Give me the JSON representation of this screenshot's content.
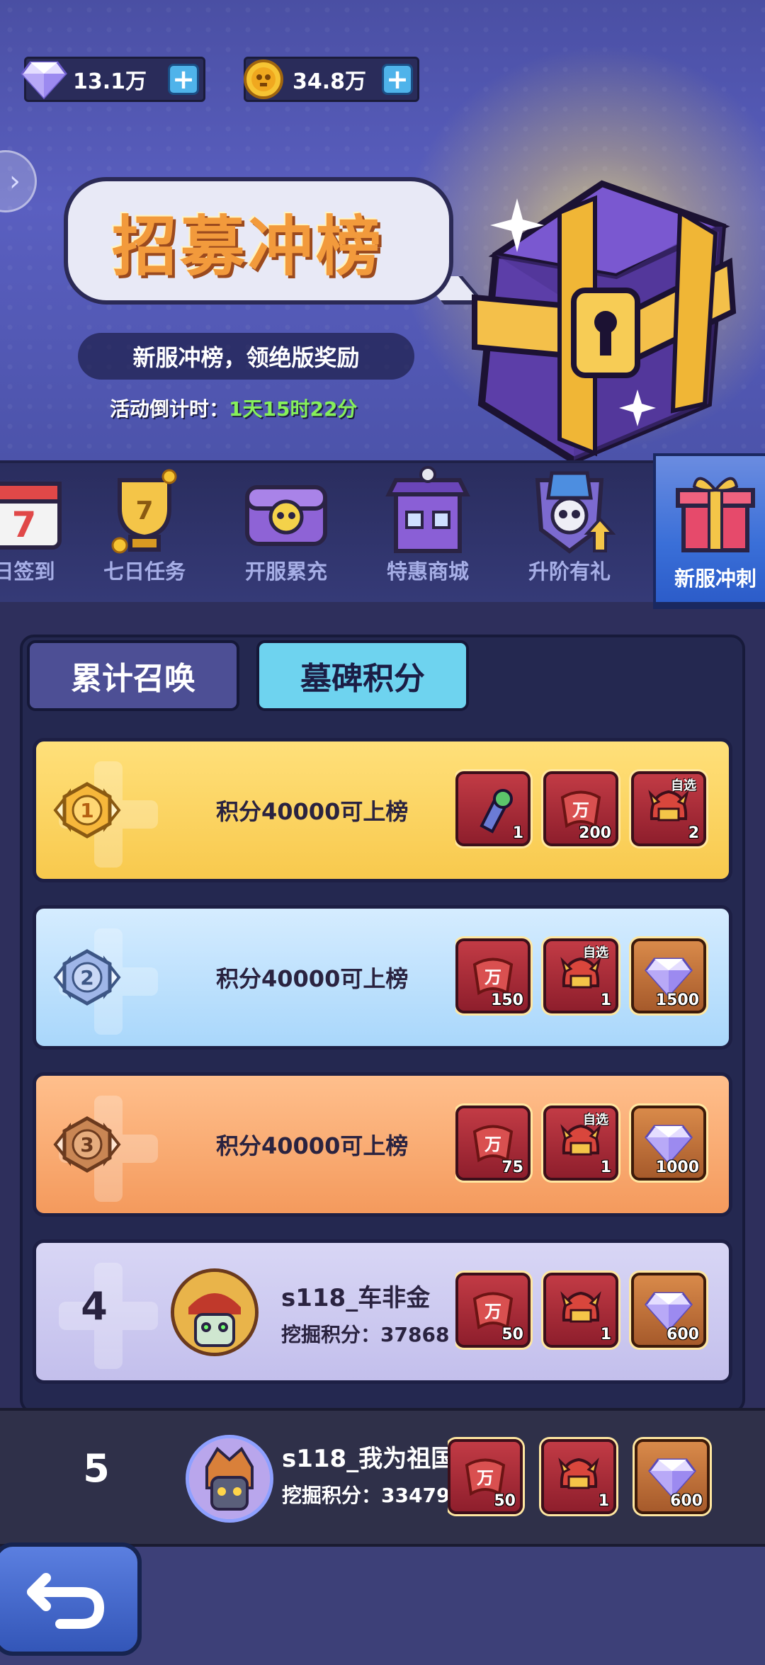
{
  "currency": {
    "gems": {
      "value": "13.1万",
      "icon": "diamond-icon"
    },
    "coins": {
      "value": "34.8万",
      "icon": "coin-icon"
    },
    "plus_label": "+"
  },
  "event": {
    "title": "招募冲榜",
    "subtitle": "新服冲榜，领绝版奖励",
    "countdown_label": "活动倒计时：",
    "countdown_value": "1天15时22分"
  },
  "tabs": [
    {
      "label": "每日签到",
      "shown_label": "日签到",
      "icon": "calendar-icon",
      "active": false
    },
    {
      "label": "七日任务",
      "icon": "trophy-icon",
      "active": false
    },
    {
      "label": "开服累充",
      "icon": "skull-chest-icon",
      "active": false
    },
    {
      "label": "特惠商城",
      "icon": "shop-icon",
      "active": false
    },
    {
      "label": "升阶有礼",
      "icon": "skull-shield-icon",
      "active": false
    },
    {
      "label": "新服冲刺",
      "icon": "gift-box-icon",
      "active": true
    }
  ],
  "segments": [
    {
      "label": "累计召唤",
      "active": false
    },
    {
      "label": "墓碑积分",
      "active": true
    }
  ],
  "ranks": [
    {
      "rank": "1",
      "requirement": "积分40000可上榜",
      "rewards": [
        {
          "icon": "potion-icon",
          "count": "1",
          "tag": ""
        },
        {
          "icon": "scroll-icon",
          "count": "200",
          "tag": ""
        },
        {
          "icon": "helmet-icon",
          "count": "2",
          "tag": "自选"
        }
      ]
    },
    {
      "rank": "2",
      "requirement": "积分40000可上榜",
      "rewards": [
        {
          "icon": "scroll-icon",
          "count": "150",
          "tag": ""
        },
        {
          "icon": "helmet-icon",
          "count": "1",
          "tag": "自选"
        },
        {
          "icon": "diamond-icon",
          "count": "1500",
          "tag": ""
        }
      ]
    },
    {
      "rank": "3",
      "requirement": "积分40000可上榜",
      "rewards": [
        {
          "icon": "scroll-icon",
          "count": "75",
          "tag": ""
        },
        {
          "icon": "helmet-icon",
          "count": "1",
          "tag": "自选"
        },
        {
          "icon": "diamond-icon",
          "count": "1000",
          "tag": ""
        }
      ]
    },
    {
      "rank": "4",
      "player": "s118_车非金",
      "score_label": "挖掘积分：",
      "score": "37868",
      "rewards": [
        {
          "icon": "scroll-icon",
          "count": "50",
          "tag": ""
        },
        {
          "icon": "helmet-icon",
          "count": "1",
          "tag": ""
        },
        {
          "icon": "diamond-icon",
          "count": "600",
          "tag": ""
        }
      ]
    }
  ],
  "my_rank": {
    "rank": "5",
    "player": "s118_我为祖国",
    "score_label": "挖掘积分：",
    "score": "33479",
    "rewards": [
      {
        "icon": "scroll-icon",
        "count": "50",
        "tag": ""
      },
      {
        "icon": "helmet-icon",
        "count": "1",
        "tag": ""
      },
      {
        "icon": "diamond-icon",
        "count": "600",
        "tag": ""
      }
    ]
  },
  "back_icon": "back-arrow-icon"
}
